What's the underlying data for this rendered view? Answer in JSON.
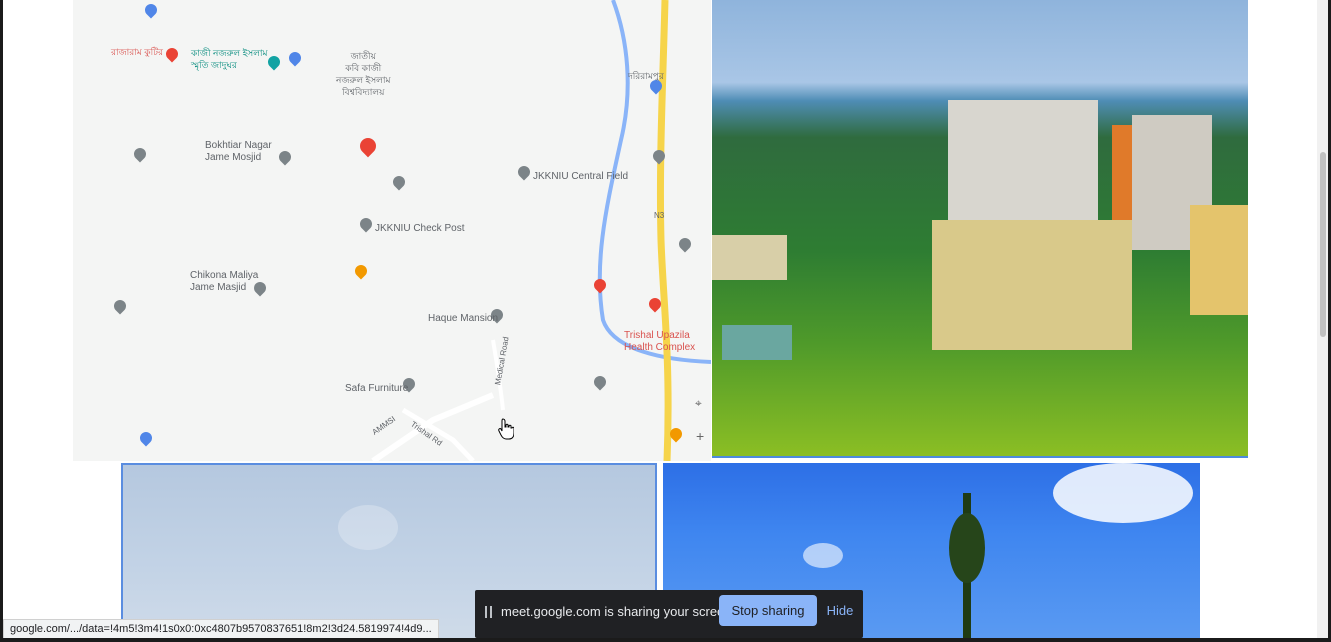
{
  "map": {
    "labels": {
      "place_1": "Bokhtiar Nagar Jame Mosjid",
      "place_2": "JKKNIU Central Field",
      "place_3": "JKKNIU Check Post",
      "place_4": "Chikona Maliya Jame Masjid",
      "place_5": "Haque Mansion",
      "place_6": "Trishal Upazila Health Complex",
      "place_7": "Safa Furniture",
      "road_1": "N3",
      "road_2": "AMMSI",
      "road_3": "Medical Road",
      "road_4": "Trishal Rd"
    },
    "bn_labels": {
      "bn_1": "জাতীয়\nকবি কাজী\nনজরুল ইসলাম\nবিশ্ববিদ্যালয়",
      "bn_2": "কাজী নজরুল ইসলাম\nস্মৃতি জাদুঘর",
      "bn_3": "রাজারাম কুটির",
      "bn_4": "দরিরামপুর"
    }
  },
  "status_url": "google.com/.../data=!4m5!3m4!1s0x0:0xc4807b9570837651!8m2!3d24.5819974!4d9...",
  "share_bar": {
    "message": "meet.google.com is sharing your screen.",
    "stop_label": "Stop sharing",
    "hide_label": "Hide"
  },
  "colors": {
    "share_bar_bg": "#202124",
    "stop_button": "#8ab4f8",
    "selection_border": "#5a8de0"
  },
  "icons": [
    "pause-icon",
    "map-pin-icon",
    "location-icon",
    "zoom-in-icon",
    "hand-cursor-icon"
  ]
}
